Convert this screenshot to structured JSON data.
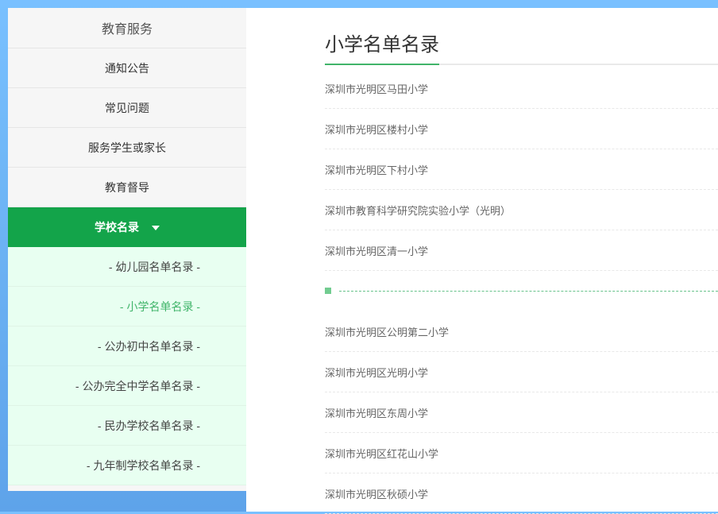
{
  "sidebar": {
    "header": "教育服务",
    "items": [
      {
        "label": "通知公告"
      },
      {
        "label": "常见问题"
      },
      {
        "label": "服务学生或家长"
      },
      {
        "label": "教育督导"
      }
    ],
    "active": {
      "label": "学校名录"
    },
    "submenu": [
      {
        "label": "- 幼儿园名单名录 -"
      },
      {
        "label": "- 小学名单名录 -"
      },
      {
        "label": "- 公办初中名单名录 -"
      },
      {
        "label": "- 公办完全中学名单名录 -"
      },
      {
        "label": "- 民办学校名单名录 -"
      },
      {
        "label": "- 九年制学校名单名录 -"
      }
    ]
  },
  "main": {
    "title": "小学名单名录",
    "schools": [
      "深圳市光明区马田小学",
      "深圳市光明区楼村小学",
      "深圳市光明区下村小学",
      "深圳市教育科学研究院实验小学（光明）",
      "深圳市光明区清一小学",
      "深圳市光明区公明第二小学",
      "深圳市光明区光明小学",
      "深圳市光明区东周小学",
      "深圳市光明区红花山小学",
      "深圳市光明区秋硕小学"
    ]
  },
  "colors": {
    "page_bg": "#79c0ff",
    "active_green": "#13a44a",
    "submenu_bg": "#e8fff1",
    "accent_green": "#41b46a"
  }
}
